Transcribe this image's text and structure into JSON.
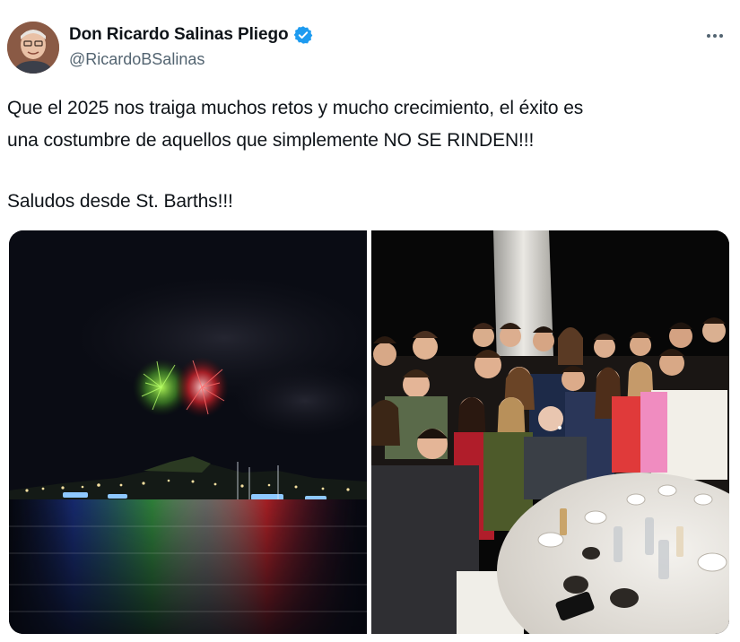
{
  "author": {
    "display_name": "Don Ricardo Salinas Pliego",
    "handle": "@RicardoBSalinas",
    "verified": true,
    "avatar_icon": "profile-photo-avatar"
  },
  "more_icon": "more-options-icon",
  "tweet": {
    "line1": "Que el 2025 nos traiga muchos retos y mucho crecimiento, el éxito es",
    "line2": "una costumbre de aquellos que simplemente NO SE RINDEN!!!",
    "line3": "Saludos desde St. Barths!!!"
  },
  "media": [
    {
      "kind": "photo",
      "subject": "fireworks over harbor at night"
    },
    {
      "kind": "photo",
      "subject": "group of people around a dinner table at night"
    }
  ],
  "colors": {
    "text_primary": "#0f1419",
    "text_secondary": "#536471",
    "verified_blue": "#1d9bf0",
    "background": "#ffffff"
  }
}
